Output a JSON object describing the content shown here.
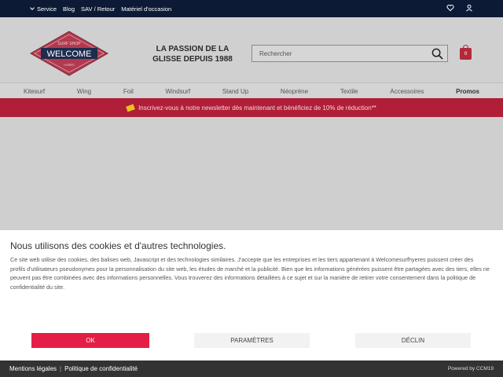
{
  "topbar": {
    "service": "Service",
    "blog": "Blog",
    "sav": "SAV / Retour",
    "occasion": "Matériel d'occasion"
  },
  "header": {
    "logo_top": "SURF SHOP",
    "logo_main": "WELCOME",
    "logo_bottom": "HYERES",
    "tagline_line1": "LA PASSION DE LA",
    "tagline_line2": "GLISSE DEPUIS 1988",
    "search_placeholder": "Rechercher",
    "cart_count": "0"
  },
  "nav": {
    "items": [
      "Kitesurf",
      "Wing",
      "Foil",
      "Windsurf",
      "Stand Up",
      "Néoprène",
      "Textile",
      "Accessoires",
      "Promos"
    ]
  },
  "banner": {
    "text": "Inscrivez-vous à notre newsletter dès maintenant et bénéficiez de 10% de réduction**"
  },
  "cookie": {
    "title": "Nous utilisons des cookies et d'autres technologies.",
    "body": "Ce site web utilise des cookies, des balises web, Javascript et des technologies similaires. J'accepte que les entreprises et les tiers appartenant à Welcomesurfhyeres puissent créer des profils d'utilisateurs pseudonymes pour la personnalisation du site web, les études de marché et la publicité. Bien que les informations générées puissent être partagées avec des tiers, elles ne peuvent pas être combinées avec des informations personnelles. Vous trouverez des informations détaillées à ce sujet et sur la manière de retirer votre consentement dans la politique de confidentialité du site.",
    "ok": "OK",
    "params": "PARAMÈTRES",
    "decline": "DÉCLIN"
  },
  "footer": {
    "legal": "Mentions légales",
    "sep": "|",
    "privacy": "Politique de confidentialité",
    "powered": "Powered by CCM19"
  },
  "colors": {
    "topbar": "#0d1a36",
    "banner": "#b01e37",
    "ok_button": "#e41e45",
    "footer": "#333333"
  }
}
